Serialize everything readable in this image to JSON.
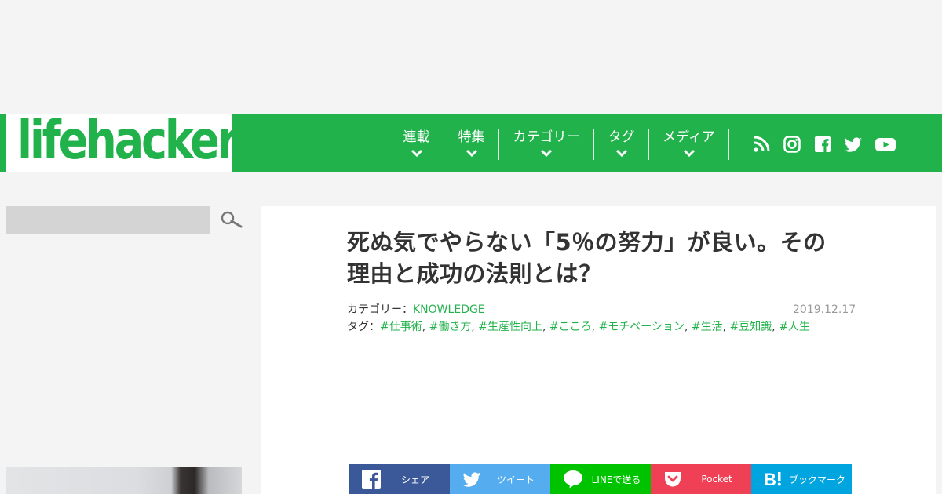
{
  "logo": {
    "text": "lifehacker"
  },
  "nav": {
    "items": [
      {
        "label": "連載"
      },
      {
        "label": "特集"
      },
      {
        "label": "カテゴリー"
      },
      {
        "label": "タグ"
      },
      {
        "label": "メディア"
      }
    ],
    "social_icons": [
      "rss-icon",
      "instagram-icon",
      "facebook-icon",
      "twitter-icon",
      "youtube-icon"
    ]
  },
  "search": {
    "value": ""
  },
  "article": {
    "title_line1": "死ぬ気でやらない「5％の努力」が良い。その",
    "title_line2": "理由と成功の法則とは？",
    "category_label": "カテゴリー：",
    "category": "KNOWLEDGE",
    "tag_label": "タグ：",
    "tags": [
      "#仕事術",
      "#働き方",
      "#生産性向上",
      "#こころ",
      "#モチベーション",
      "#生活",
      "#豆知識",
      "#人生"
    ],
    "date": "2019.12.17"
  },
  "share": {
    "buttons": [
      {
        "label": "シェア"
      },
      {
        "label": "ツイート"
      },
      {
        "label": "LINEで送る"
      },
      {
        "label": "Pocket"
      },
      {
        "label": "ブックマーク"
      }
    ]
  },
  "colors": {
    "brand_green": "#22b24c",
    "facebook": "#3b5998",
    "twitter": "#55acee",
    "line": "#00c300",
    "pocket": "#ef4056",
    "hatena": "#00a4de"
  }
}
